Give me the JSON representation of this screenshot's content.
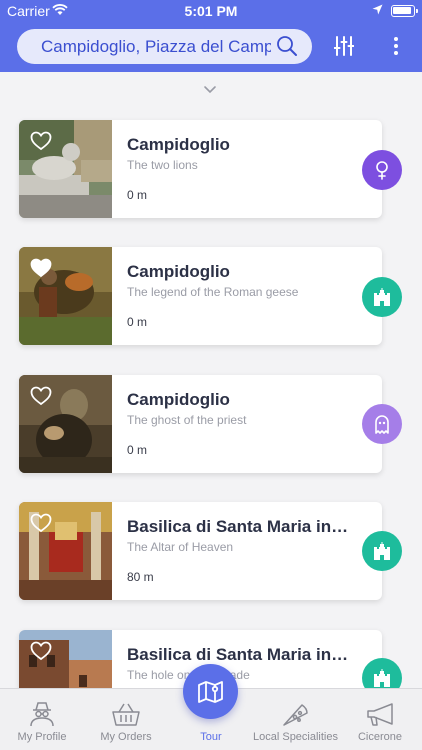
{
  "status_bar": {
    "carrier": "Carrier",
    "time": "5:01 PM"
  },
  "header": {
    "search_value": "Campidoglio, Piazza del Campidoglio"
  },
  "colors": {
    "primary": "#5b6fe8",
    "purple": "#7d4fe0",
    "teal": "#1ebc9c",
    "lilac": "#a57ee8"
  },
  "places": [
    {
      "title": "Campidoglio",
      "subtitle": "The two lions",
      "distance": "0 m",
      "favorite": false,
      "category": "pin-icon"
    },
    {
      "title": "Campidoglio",
      "subtitle": "The legend of the Roman geese",
      "distance": "0 m",
      "favorite": true,
      "category": "castle-icon"
    },
    {
      "title": "Campidoglio",
      "subtitle": "The ghost of the priest",
      "distance": "0 m",
      "favorite": false,
      "category": "ghost-icon"
    },
    {
      "title": "Basilica di Santa Maria in Aracoeli",
      "subtitle": "The Altar of Heaven",
      "distance": "80 m",
      "favorite": false,
      "category": "castle-icon"
    },
    {
      "title": "Basilica di Santa Maria in Aracoeli",
      "subtitle": "The hole on the facade",
      "distance": "",
      "favorite": false,
      "category": "castle-icon"
    }
  ],
  "tabs": [
    {
      "label": "My Profile",
      "icon": "detective-icon"
    },
    {
      "label": "My Orders",
      "icon": "basket-icon"
    },
    {
      "label": "Tour",
      "icon": "map-icon"
    },
    {
      "label": "Local Specialities",
      "icon": "pizza-icon"
    },
    {
      "label": "Cicerone",
      "icon": "megaphone-icon"
    }
  ]
}
